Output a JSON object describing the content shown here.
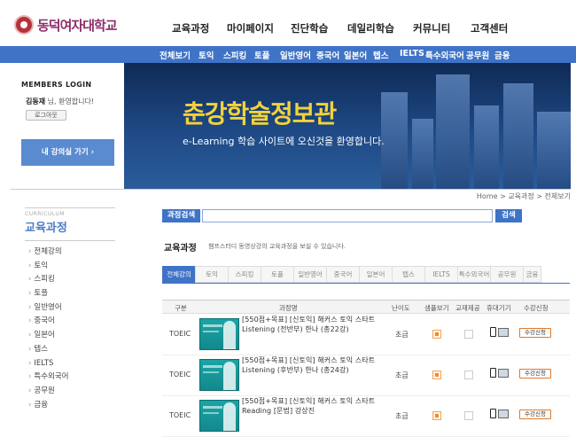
{
  "header": {
    "logo_text": "동덕여자대학교",
    "nav": [
      "교육과정",
      "마이페이지",
      "진단학습",
      "데일리학습",
      "커뮤니티",
      "고객센터"
    ]
  },
  "subnav": [
    "전체보기",
    "토익",
    "스피킹",
    "토플",
    "일반영어",
    "중국어",
    "일본어",
    "텝스",
    "IELTS",
    "특수외국어",
    "공무원",
    "금융"
  ],
  "login": {
    "title": "MEMBERS LOGIN",
    "user_name": "김동재",
    "greeting": " 님, 환영합니다!",
    "logout_label": "로그아웃",
    "my_class_label": "내 강의실 가기 ›"
  },
  "banner": {
    "title": "춘강학술정보관",
    "subtitle": "e-Learning 학습 사이트에 오신것을 환영합니다."
  },
  "breadcrumb": "Home > 교육과정 > 전체보기",
  "sidebar": {
    "eyebrow": "CURRICULUM",
    "title": "교육과정",
    "items": [
      "전체강의",
      "토익",
      "스피킹",
      "토플",
      "일반영어",
      "중국어",
      "일본어",
      "텝스",
      "IELTS",
      "특수외국어",
      "공무원",
      "금융"
    ]
  },
  "search": {
    "label": "과정검색",
    "button": "검색",
    "value": ""
  },
  "section": {
    "title": "교육과정",
    "description": "챔프스터디 동영상강의 교육과정을 보실 수 있습니다."
  },
  "tabs": [
    "전체강의",
    "토익",
    "스피킹",
    "토플",
    "일반영어",
    "중국어",
    "일본어",
    "텝스",
    "IELTS",
    "특수외국어",
    "공무원",
    "금융"
  ],
  "table": {
    "columns": [
      "구분",
      "과정명",
      "난이도",
      "샘플보기",
      "교재제공",
      "휴대기기",
      "수강신청"
    ],
    "rows": [
      {
        "category": "TOEIC",
        "title": "[550점+목표] [신토익] 해커스 토익 스타트 Listening (전반부) 한나 (총22강)",
        "level": "초급",
        "apply": "수강신청"
      },
      {
        "category": "TOEIC",
        "title": "[550점+목표] [신토익] 해커스 토익 스타트 Listening (후반부) 한나 (총24강)",
        "level": "초급",
        "apply": "수강신청"
      },
      {
        "category": "TOEIC",
        "title": "[550점+목표] [신토익] 해커스 토익 스타트 Reading [문법] 강상진",
        "level": "초급",
        "apply": "수강신청"
      }
    ]
  },
  "colors": {
    "primary": "#3f73c6",
    "banner_title": "#f2d23c",
    "logo": "#8e2f6b"
  }
}
